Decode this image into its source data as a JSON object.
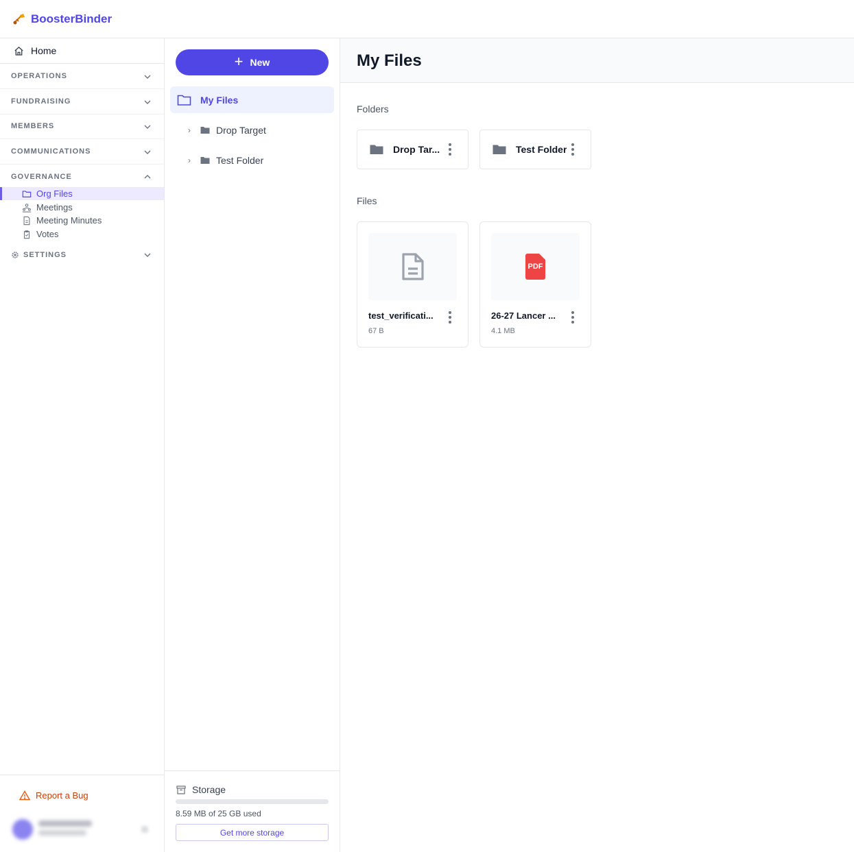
{
  "app": {
    "brand": "BoosterBinder",
    "brand_icon": "trumpet-icon",
    "brand_color": "#4f46e5"
  },
  "sidebar": {
    "home": "Home",
    "sections": {
      "operations": "OPERATIONS",
      "fundraising": "FUNDRAISING",
      "members": "MEMBERS",
      "communications": "COMMUNICATIONS",
      "governance": "GOVERNANCE",
      "settings": "SETTINGS"
    },
    "governance_items": {
      "org_files": "Org Files",
      "meetings": "Meetings",
      "meeting_minutes": "Meeting Minutes",
      "votes": "Votes"
    },
    "report_bug": "Report a Bug"
  },
  "tree": {
    "new_button": "New",
    "root": "My Files",
    "folders": [
      "Drop Target",
      "Test Folder"
    ]
  },
  "storage": {
    "title": "Storage",
    "used_text": "8.59 MB of 25 GB used",
    "used_fraction": 0.0003,
    "more_button": "Get more storage"
  },
  "main": {
    "title": "My Files",
    "folders_heading": "Folders",
    "files_heading": "Files",
    "folders": [
      {
        "name": "Drop Tar..."
      },
      {
        "name": "Test Folder"
      }
    ],
    "files": [
      {
        "name": "test_verificati...",
        "size": "67 B",
        "icon": "document-icon"
      },
      {
        "name": "26-27 Lancer ...",
        "size": "4.1 MB",
        "icon": "pdf-icon",
        "badge": "PDF"
      }
    ]
  },
  "colors": {
    "accent": "#4f46e5",
    "active_bg": "#eef2ff",
    "warning": "#c2410c",
    "pdf": "#ef4444"
  }
}
